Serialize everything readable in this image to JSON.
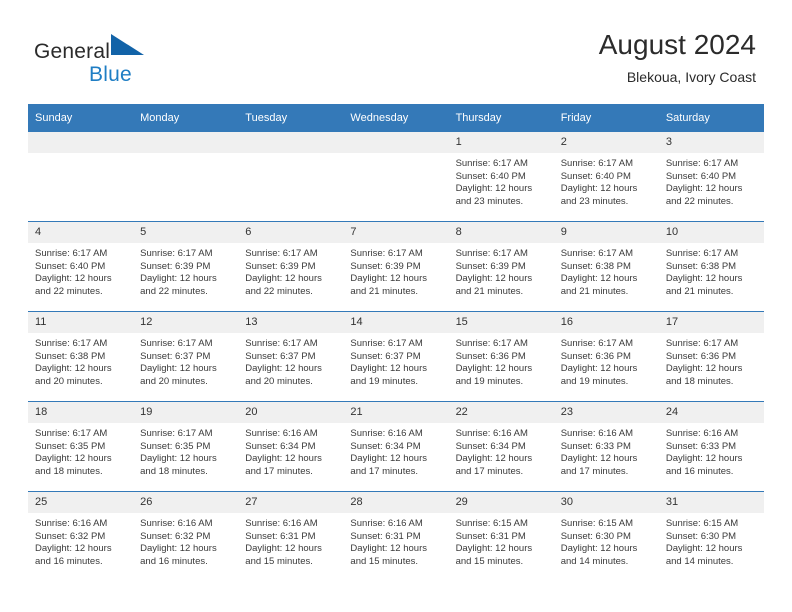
{
  "brand": {
    "name_part1": "General",
    "name_part2": "Blue",
    "logo_icon": "blue-triangle-flag-icon",
    "accent_color": "#1f7ec4"
  },
  "header": {
    "title": "August 2024",
    "subtitle": "Blekoua, Ivory Coast"
  },
  "theme": {
    "header_row_bg": "#3479b8",
    "daynum_bg": "#f0f0f0",
    "grid_line": "#3479b8"
  },
  "weekdays": [
    "Sunday",
    "Monday",
    "Tuesday",
    "Wednesday",
    "Thursday",
    "Friday",
    "Saturday"
  ],
  "weeks": [
    [
      {
        "day": "",
        "sunrise": "",
        "sunset": "",
        "daylight_line1": "",
        "daylight_line2": ""
      },
      {
        "day": "",
        "sunrise": "",
        "sunset": "",
        "daylight_line1": "",
        "daylight_line2": ""
      },
      {
        "day": "",
        "sunrise": "",
        "sunset": "",
        "daylight_line1": "",
        "daylight_line2": ""
      },
      {
        "day": "",
        "sunrise": "",
        "sunset": "",
        "daylight_line1": "",
        "daylight_line2": ""
      },
      {
        "day": "1",
        "sunrise": "Sunrise: 6:17 AM",
        "sunset": "Sunset: 6:40 PM",
        "daylight_line1": "Daylight: 12 hours",
        "daylight_line2": "and 23 minutes."
      },
      {
        "day": "2",
        "sunrise": "Sunrise: 6:17 AM",
        "sunset": "Sunset: 6:40 PM",
        "daylight_line1": "Daylight: 12 hours",
        "daylight_line2": "and 23 minutes."
      },
      {
        "day": "3",
        "sunrise": "Sunrise: 6:17 AM",
        "sunset": "Sunset: 6:40 PM",
        "daylight_line1": "Daylight: 12 hours",
        "daylight_line2": "and 22 minutes."
      }
    ],
    [
      {
        "day": "4",
        "sunrise": "Sunrise: 6:17 AM",
        "sunset": "Sunset: 6:40 PM",
        "daylight_line1": "Daylight: 12 hours",
        "daylight_line2": "and 22 minutes."
      },
      {
        "day": "5",
        "sunrise": "Sunrise: 6:17 AM",
        "sunset": "Sunset: 6:39 PM",
        "daylight_line1": "Daylight: 12 hours",
        "daylight_line2": "and 22 minutes."
      },
      {
        "day": "6",
        "sunrise": "Sunrise: 6:17 AM",
        "sunset": "Sunset: 6:39 PM",
        "daylight_line1": "Daylight: 12 hours",
        "daylight_line2": "and 22 minutes."
      },
      {
        "day": "7",
        "sunrise": "Sunrise: 6:17 AM",
        "sunset": "Sunset: 6:39 PM",
        "daylight_line1": "Daylight: 12 hours",
        "daylight_line2": "and 21 minutes."
      },
      {
        "day": "8",
        "sunrise": "Sunrise: 6:17 AM",
        "sunset": "Sunset: 6:39 PM",
        "daylight_line1": "Daylight: 12 hours",
        "daylight_line2": "and 21 minutes."
      },
      {
        "day": "9",
        "sunrise": "Sunrise: 6:17 AM",
        "sunset": "Sunset: 6:38 PM",
        "daylight_line1": "Daylight: 12 hours",
        "daylight_line2": "and 21 minutes."
      },
      {
        "day": "10",
        "sunrise": "Sunrise: 6:17 AM",
        "sunset": "Sunset: 6:38 PM",
        "daylight_line1": "Daylight: 12 hours",
        "daylight_line2": "and 21 minutes."
      }
    ],
    [
      {
        "day": "11",
        "sunrise": "Sunrise: 6:17 AM",
        "sunset": "Sunset: 6:38 PM",
        "daylight_line1": "Daylight: 12 hours",
        "daylight_line2": "and 20 minutes."
      },
      {
        "day": "12",
        "sunrise": "Sunrise: 6:17 AM",
        "sunset": "Sunset: 6:37 PM",
        "daylight_line1": "Daylight: 12 hours",
        "daylight_line2": "and 20 minutes."
      },
      {
        "day": "13",
        "sunrise": "Sunrise: 6:17 AM",
        "sunset": "Sunset: 6:37 PM",
        "daylight_line1": "Daylight: 12 hours",
        "daylight_line2": "and 20 minutes."
      },
      {
        "day": "14",
        "sunrise": "Sunrise: 6:17 AM",
        "sunset": "Sunset: 6:37 PM",
        "daylight_line1": "Daylight: 12 hours",
        "daylight_line2": "and 19 minutes."
      },
      {
        "day": "15",
        "sunrise": "Sunrise: 6:17 AM",
        "sunset": "Sunset: 6:36 PM",
        "daylight_line1": "Daylight: 12 hours",
        "daylight_line2": "and 19 minutes."
      },
      {
        "day": "16",
        "sunrise": "Sunrise: 6:17 AM",
        "sunset": "Sunset: 6:36 PM",
        "daylight_line1": "Daylight: 12 hours",
        "daylight_line2": "and 19 minutes."
      },
      {
        "day": "17",
        "sunrise": "Sunrise: 6:17 AM",
        "sunset": "Sunset: 6:36 PM",
        "daylight_line1": "Daylight: 12 hours",
        "daylight_line2": "and 18 minutes."
      }
    ],
    [
      {
        "day": "18",
        "sunrise": "Sunrise: 6:17 AM",
        "sunset": "Sunset: 6:35 PM",
        "daylight_line1": "Daylight: 12 hours",
        "daylight_line2": "and 18 minutes."
      },
      {
        "day": "19",
        "sunrise": "Sunrise: 6:17 AM",
        "sunset": "Sunset: 6:35 PM",
        "daylight_line1": "Daylight: 12 hours",
        "daylight_line2": "and 18 minutes."
      },
      {
        "day": "20",
        "sunrise": "Sunrise: 6:16 AM",
        "sunset": "Sunset: 6:34 PM",
        "daylight_line1": "Daylight: 12 hours",
        "daylight_line2": "and 17 minutes."
      },
      {
        "day": "21",
        "sunrise": "Sunrise: 6:16 AM",
        "sunset": "Sunset: 6:34 PM",
        "daylight_line1": "Daylight: 12 hours",
        "daylight_line2": "and 17 minutes."
      },
      {
        "day": "22",
        "sunrise": "Sunrise: 6:16 AM",
        "sunset": "Sunset: 6:34 PM",
        "daylight_line1": "Daylight: 12 hours",
        "daylight_line2": "and 17 minutes."
      },
      {
        "day": "23",
        "sunrise": "Sunrise: 6:16 AM",
        "sunset": "Sunset: 6:33 PM",
        "daylight_line1": "Daylight: 12 hours",
        "daylight_line2": "and 17 minutes."
      },
      {
        "day": "24",
        "sunrise": "Sunrise: 6:16 AM",
        "sunset": "Sunset: 6:33 PM",
        "daylight_line1": "Daylight: 12 hours",
        "daylight_line2": "and 16 minutes."
      }
    ],
    [
      {
        "day": "25",
        "sunrise": "Sunrise: 6:16 AM",
        "sunset": "Sunset: 6:32 PM",
        "daylight_line1": "Daylight: 12 hours",
        "daylight_line2": "and 16 minutes."
      },
      {
        "day": "26",
        "sunrise": "Sunrise: 6:16 AM",
        "sunset": "Sunset: 6:32 PM",
        "daylight_line1": "Daylight: 12 hours",
        "daylight_line2": "and 16 minutes."
      },
      {
        "day": "27",
        "sunrise": "Sunrise: 6:16 AM",
        "sunset": "Sunset: 6:31 PM",
        "daylight_line1": "Daylight: 12 hours",
        "daylight_line2": "and 15 minutes."
      },
      {
        "day": "28",
        "sunrise": "Sunrise: 6:16 AM",
        "sunset": "Sunset: 6:31 PM",
        "daylight_line1": "Daylight: 12 hours",
        "daylight_line2": "and 15 minutes."
      },
      {
        "day": "29",
        "sunrise": "Sunrise: 6:15 AM",
        "sunset": "Sunset: 6:31 PM",
        "daylight_line1": "Daylight: 12 hours",
        "daylight_line2": "and 15 minutes."
      },
      {
        "day": "30",
        "sunrise": "Sunrise: 6:15 AM",
        "sunset": "Sunset: 6:30 PM",
        "daylight_line1": "Daylight: 12 hours",
        "daylight_line2": "and 14 minutes."
      },
      {
        "day": "31",
        "sunrise": "Sunrise: 6:15 AM",
        "sunset": "Sunset: 6:30 PM",
        "daylight_line1": "Daylight: 12 hours",
        "daylight_line2": "and 14 minutes."
      }
    ]
  ]
}
